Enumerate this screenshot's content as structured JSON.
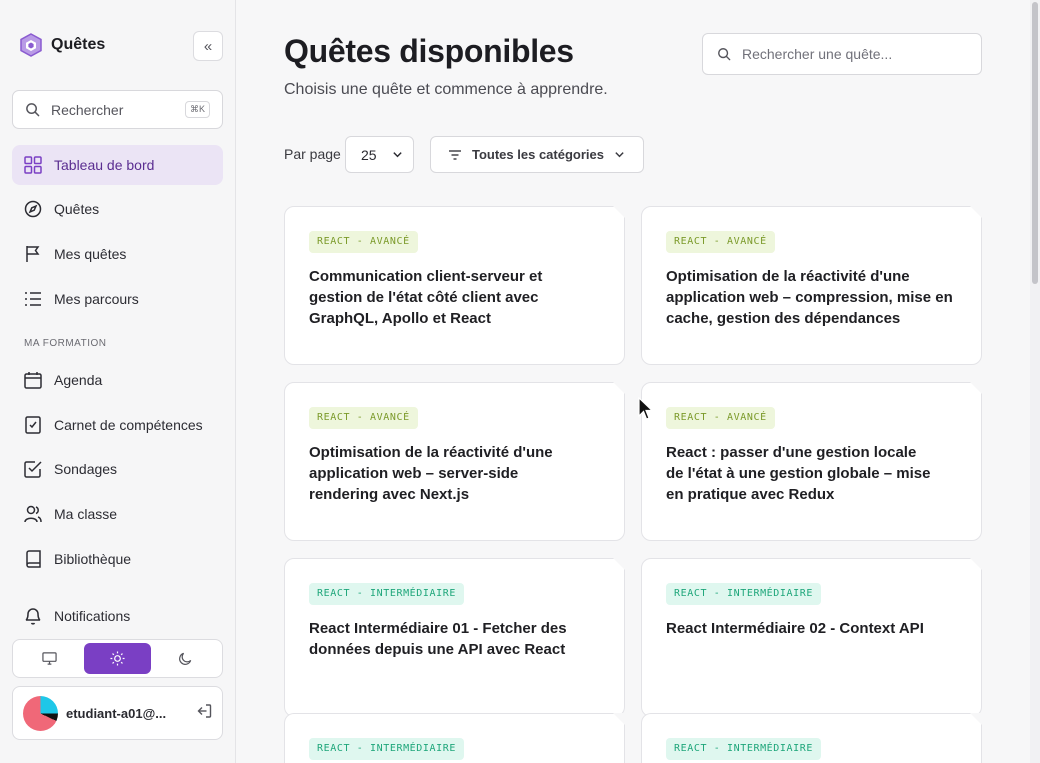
{
  "brand": {
    "name": "Quêtes"
  },
  "sidebar": {
    "search_placeholder": "Rechercher",
    "search_shortcut": "⌘K",
    "items": [
      {
        "label": "Tableau de bord",
        "icon": "grid-icon",
        "active": true
      },
      {
        "label": "Quêtes",
        "icon": "compass-icon"
      },
      {
        "label": "Mes quêtes",
        "icon": "flag-icon"
      },
      {
        "label": "Mes parcours",
        "icon": "list-icon"
      }
    ],
    "section_label": "MA FORMATION",
    "formation_items": [
      {
        "label": "Agenda",
        "icon": "calendar-icon"
      },
      {
        "label": "Carnet de compétences",
        "icon": "clipboard-icon"
      },
      {
        "label": "Sondages",
        "icon": "checkbox-icon"
      },
      {
        "label": "Ma classe",
        "icon": "users-icon"
      },
      {
        "label": "Bibliothèque",
        "icon": "book-icon"
      },
      {
        "label": "Notifications",
        "icon": "bell-icon"
      }
    ],
    "theme_options": [
      "monitor-icon",
      "sun-icon",
      "moon-icon"
    ],
    "theme_active": "sun-icon",
    "user_email": "etudiant-a01@..."
  },
  "header": {
    "title": "Quêtes disponibles",
    "subtitle": "Choisis une quête et commence à apprendre.",
    "search_placeholder": "Rechercher une quête..."
  },
  "filters": {
    "per_page_label": "Par page",
    "per_page_value": "25",
    "category_value": "Toutes les catégories"
  },
  "cards": [
    {
      "tag": "REACT - AVANCÉ",
      "level": "adv",
      "title": "Communication client-serveur et gestion de l'état côté client avec GraphQL, Apollo et React"
    },
    {
      "tag": "REACT - AVANCÉ",
      "level": "adv",
      "title": "Optimisation de la réactivité d'une application web – compression, mise en cache, gestion des dépendances"
    },
    {
      "tag": "REACT - AVANCÉ",
      "level": "adv",
      "title": "Optimisation de la réactivité d'une application web – server-side rendering avec Next.js"
    },
    {
      "tag": "REACT - AVANCÉ",
      "level": "adv",
      "title": "React : passer d'une gestion locale de l'état à une gestion globale – mise en pratique avec Redux"
    },
    {
      "tag": "REACT - INTERMÉDIAIRE",
      "level": "mid",
      "title": "React Intermédiaire 01 - Fetcher des données depuis une API avec React"
    },
    {
      "tag": "REACT - INTERMÉDIAIRE",
      "level": "mid",
      "title": "React Intermédiaire 02 - Context API"
    },
    {
      "tag": "REACT - INTERMÉDIAIRE",
      "level": "mid",
      "title": ""
    },
    {
      "tag": "REACT - INTERMÉDIAIRE",
      "level": "mid",
      "title": ""
    }
  ],
  "colors": {
    "accent": "#7a3fc4",
    "active_bg": "#ebe4f5",
    "tag_advanced": "#7b9a2a",
    "tag_intermediate": "#1ea67a"
  }
}
